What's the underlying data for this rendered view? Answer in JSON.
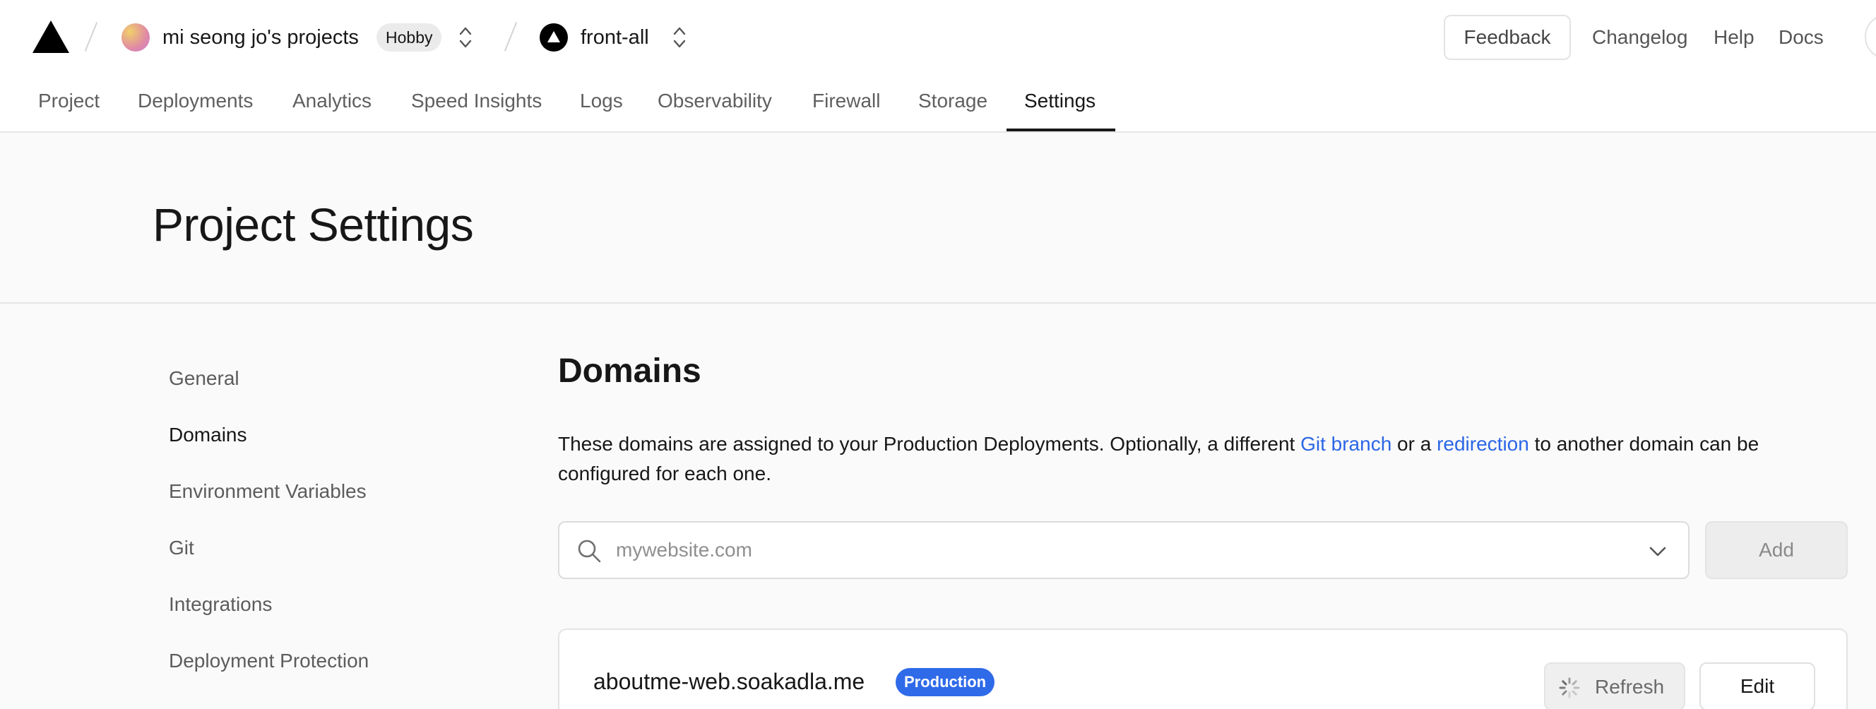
{
  "header": {
    "team_name": "mi seong jo's projects",
    "plan_badge": "Hobby",
    "project_name": "front-all",
    "feedback_label": "Feedback",
    "links": [
      "Changelog",
      "Help",
      "Docs"
    ]
  },
  "tabs": [
    "Project",
    "Deployments",
    "Analytics",
    "Speed Insights",
    "Logs",
    "Observability",
    "Firewall",
    "Storage",
    "Settings"
  ],
  "active_tab": "Settings",
  "page_title": "Project Settings",
  "sidebar": {
    "items": [
      "General",
      "Domains",
      "Environment Variables",
      "Git",
      "Integrations",
      "Deployment Protection"
    ],
    "active": "Domains"
  },
  "domains": {
    "title": "Domains",
    "description_before": "These domains are assigned to your Production Deployments. Optionally, a different ",
    "link_git_branch": "Git branch",
    "description_middle": " or a ",
    "link_redirection": "redirection",
    "description_after": " to another domain can be configured for each one.",
    "input_placeholder": "mywebsite.com",
    "input_value": "",
    "add_label": "Add",
    "entries": [
      {
        "name": "aboutme-web.soakadla.me",
        "badge": "Production",
        "refresh_label": "Refresh",
        "edit_label": "Edit"
      }
    ]
  },
  "colors": {
    "link": "#2b66e6",
    "badge": "#2f6ae8",
    "text": "#171717"
  }
}
